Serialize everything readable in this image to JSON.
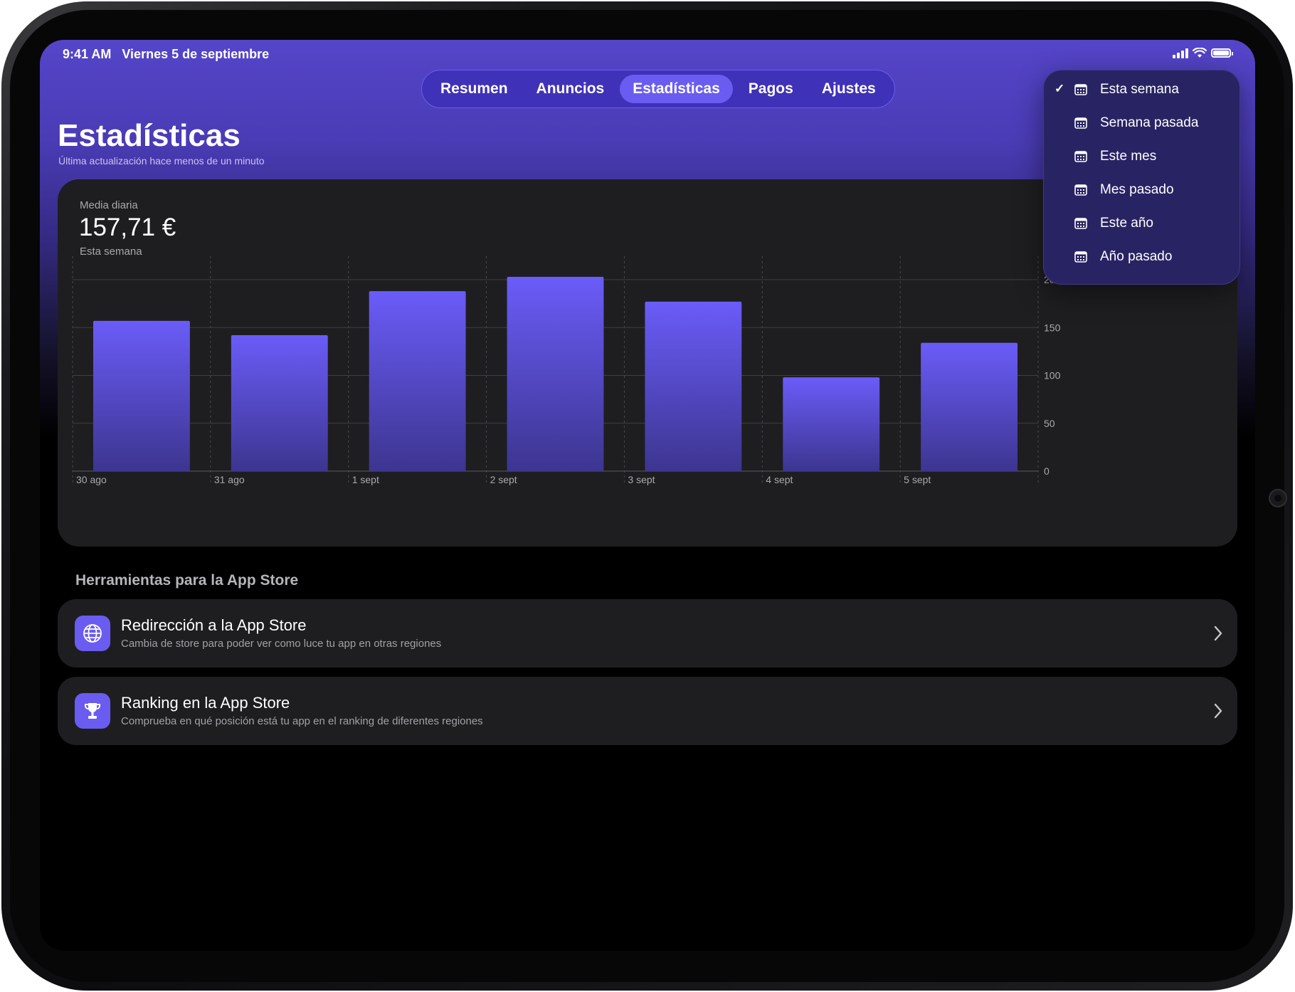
{
  "status_bar": {
    "time": "9:41 AM",
    "date": "Viernes 5 de septiembre"
  },
  "tabs": [
    {
      "label": "Resumen",
      "active": false
    },
    {
      "label": "Anuncios",
      "active": false
    },
    {
      "label": "Estadísticas",
      "active": true
    },
    {
      "label": "Pagos",
      "active": false
    },
    {
      "label": "Ajustes",
      "active": false
    }
  ],
  "page": {
    "title": "Estadísticas",
    "subtitle": "Última actualización hace menos de un minuto"
  },
  "stats": {
    "avg_label": "Media diaria",
    "avg_value": "157,71 €",
    "avg_period": "Esta semana"
  },
  "chart_data": {
    "type": "bar",
    "categories": [
      "30 ago",
      "31 ago",
      "1 sept",
      "2 sept",
      "3 sept",
      "4 sept",
      "5 sept"
    ],
    "values": [
      157,
      142,
      188,
      203,
      177,
      98,
      134
    ],
    "ylim": [
      0,
      200
    ],
    "yticks": [
      0,
      50,
      100,
      150,
      200
    ],
    "y_axis_side": "right",
    "grid": true,
    "bar_color_top": "#6a5cf8",
    "bar_color_bottom": "#3d3590"
  },
  "tools": {
    "section_title": "Herramientas para la App Store",
    "items": [
      {
        "title": "Redirección a la App Store",
        "subtitle": "Cambia de store para poder ver como luce tu app en otras regiones",
        "icon": "globe-icon"
      },
      {
        "title": "Ranking en la App Store",
        "subtitle": "Comprueba en qué posición está tu app en el ranking de diferentes regiones",
        "icon": "trophy-icon"
      }
    ]
  },
  "period_menu": {
    "items": [
      {
        "label": "Esta semana",
        "checked": true
      },
      {
        "label": "Semana pasada",
        "checked": false
      },
      {
        "label": "Este mes",
        "checked": false
      },
      {
        "label": "Mes pasado",
        "checked": false
      },
      {
        "label": "Este año",
        "checked": false
      },
      {
        "label": "Año pasado",
        "checked": false
      }
    ]
  },
  "colors": {
    "accent": "#6a5cf0",
    "tabbar": "#3f32b8",
    "card": "#1e1e21"
  }
}
